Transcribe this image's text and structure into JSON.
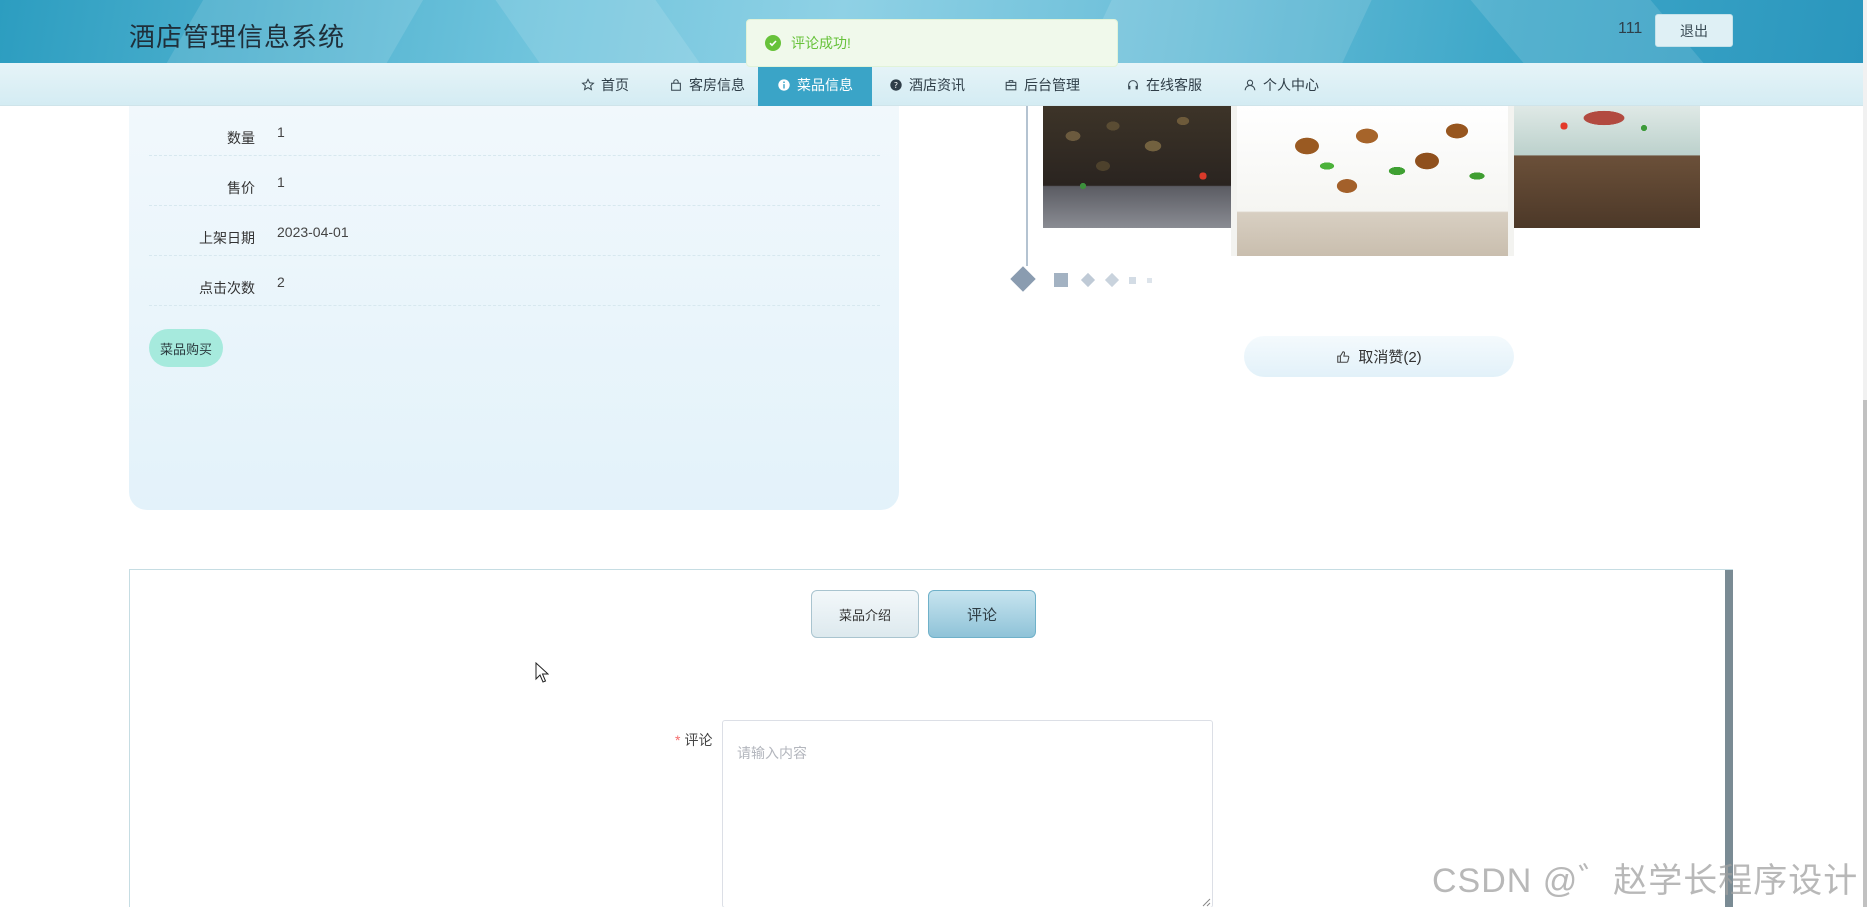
{
  "header": {
    "site_title": "酒店管理信息系统",
    "username": "111",
    "logout_label": "退出"
  },
  "nav": {
    "items": [
      {
        "label": "首页",
        "icon": "star-icon",
        "active": false
      },
      {
        "label": "客房信息",
        "icon": "bag-icon",
        "active": false
      },
      {
        "label": "菜品信息",
        "icon": "info-icon",
        "active": true
      },
      {
        "label": "酒店资讯",
        "icon": "question-icon",
        "active": false
      },
      {
        "label": "后台管理",
        "icon": "briefcase-icon",
        "active": false
      },
      {
        "label": "在线客服",
        "icon": "headset-icon",
        "active": false
      },
      {
        "label": "个人中心",
        "icon": "user-icon",
        "active": false
      }
    ]
  },
  "toast": {
    "message": "评论成功!",
    "color": "#67c23a"
  },
  "detail": {
    "rows": [
      {
        "label": "数量",
        "value": "1"
      },
      {
        "label": "售价",
        "value": "1"
      },
      {
        "label": "上架日期",
        "value": "2023-04-01"
      },
      {
        "label": "点击次数",
        "value": "2"
      }
    ],
    "buy_label": "菜品购买"
  },
  "carousel": {
    "slides": [
      "clams-dish",
      "chicken-pepper-dish",
      "beef-salad-dish"
    ],
    "like_label": "取消赞(2)"
  },
  "tabs": {
    "intro_label": "菜品介绍",
    "comment_label": "评论"
  },
  "comment_form": {
    "required_mark": "*",
    "label": "评论",
    "placeholder": "请输入内容",
    "value": ""
  },
  "watermark": "CSDN @゛赵学长程序设计",
  "colors": {
    "accent": "#3aa4c7",
    "buy_button": "#a6eadd",
    "required": "#f56c6c"
  }
}
